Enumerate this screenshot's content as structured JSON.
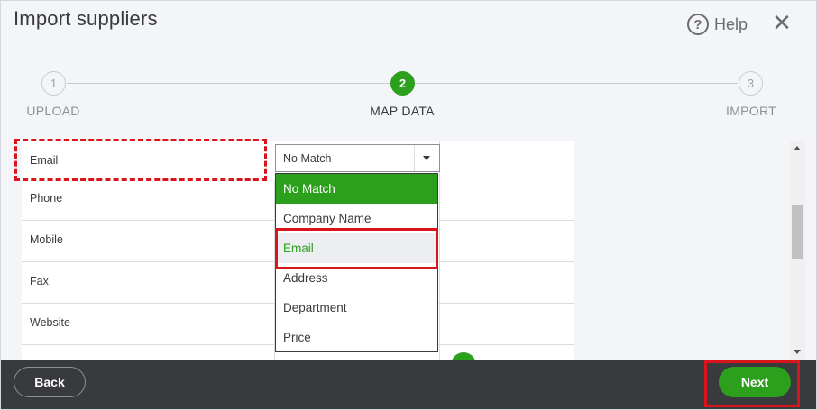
{
  "dialog": {
    "title": "Import suppliers",
    "help_label": "Help",
    "help_icon_glyph": "?",
    "close_glyph": "✕"
  },
  "stepper": {
    "steps": [
      {
        "number": "1",
        "label": "UPLOAD",
        "state": "inactive"
      },
      {
        "number": "2",
        "label": "MAP DATA",
        "state": "active"
      },
      {
        "number": "3",
        "label": "IMPORT",
        "state": "inactive"
      }
    ]
  },
  "mapping": {
    "rows": [
      {
        "label": "Email"
      },
      {
        "label": "Phone"
      },
      {
        "label": "Mobile"
      },
      {
        "label": "Fax"
      },
      {
        "label": "Website"
      }
    ],
    "select": {
      "value": "No Match",
      "options": [
        "No Match",
        "Company Name",
        "Email",
        "Address",
        "Department",
        "Price"
      ],
      "selected_option": "No Match",
      "hovered_option": "Email"
    }
  },
  "footer": {
    "back_label": "Back",
    "next_label": "Next"
  },
  "colors": {
    "accent_green": "#2ca01c",
    "annotation_red": "#d9141b",
    "footer_bg": "#393a3d"
  }
}
